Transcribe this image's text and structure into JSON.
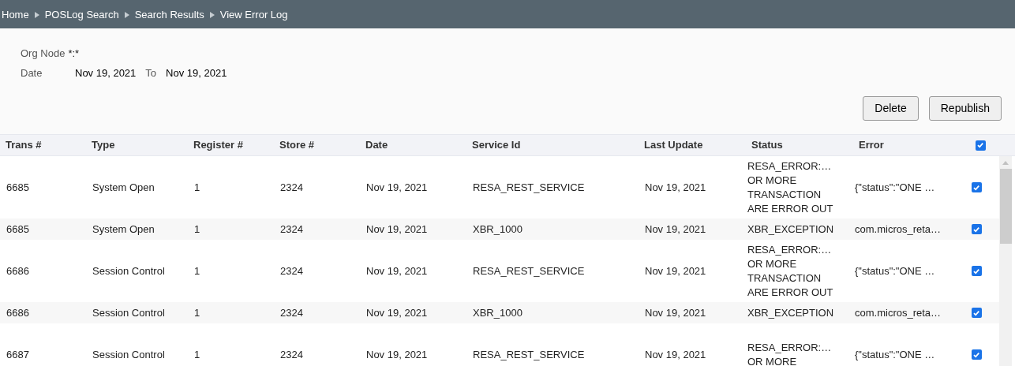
{
  "breadcrumb": [
    "Home",
    "POSLog Search",
    "Search Results",
    "View Error Log"
  ],
  "filters": {
    "org_node_label": "Org Node",
    "org_node_value": "*:*",
    "date_label": "Date",
    "date_from": "Nov 19, 2021",
    "to_label": "To",
    "date_to": "Nov 19, 2021"
  },
  "buttons": [
    "Delete",
    "Republish"
  ],
  "table": {
    "columns": [
      "Trans #",
      "Type",
      "Register #",
      "Store #",
      "Date",
      "Service Id",
      "Last Update",
      "Status",
      "Error"
    ],
    "select_all_checked": true,
    "rows": [
      {
        "cells": [
          "6685",
          "System Open",
          "1",
          "2324",
          "Nov 19, 2021",
          "RESA_REST_SERVICE",
          "Nov 19, 2021"
        ],
        "status": [
          "RESA_ERROR:…",
          "OR MORE",
          "TRANSACTION",
          "ARE ERROR OUT"
        ],
        "error": "{\"status\":\"ONE …",
        "checked": true
      },
      {
        "cells": [
          "6685",
          "System Open",
          "1",
          "2324",
          "Nov 19, 2021",
          "XBR_1000",
          "Nov 19, 2021"
        ],
        "status": [
          "XBR_EXCEPTION"
        ],
        "error": "com.micros_reta…",
        "checked": true
      },
      {
        "cells": [
          "6686",
          "Session Control",
          "1",
          "2324",
          "Nov 19, 2021",
          "RESA_REST_SERVICE",
          "Nov 19, 2021"
        ],
        "status": [
          "RESA_ERROR:…",
          "OR MORE",
          "TRANSACTION",
          "ARE ERROR OUT"
        ],
        "error": "{\"status\":\"ONE …",
        "checked": true
      },
      {
        "cells": [
          "6686",
          "Session Control",
          "1",
          "2324",
          "Nov 19, 2021",
          "XBR_1000",
          "Nov 19, 2021"
        ],
        "status": [
          "XBR_EXCEPTION"
        ],
        "error": "com.micros_reta…",
        "checked": true
      },
      {
        "cells": [
          "6687",
          "Session Control",
          "1",
          "2324",
          "Nov 19, 2021",
          "RESA_REST_SERVICE",
          "Nov 19, 2021"
        ],
        "status": [
          "RESA_ERROR:…",
          "OR MORE"
        ],
        "error": "{\"status\":\"ONE …",
        "checked": true
      }
    ]
  }
}
